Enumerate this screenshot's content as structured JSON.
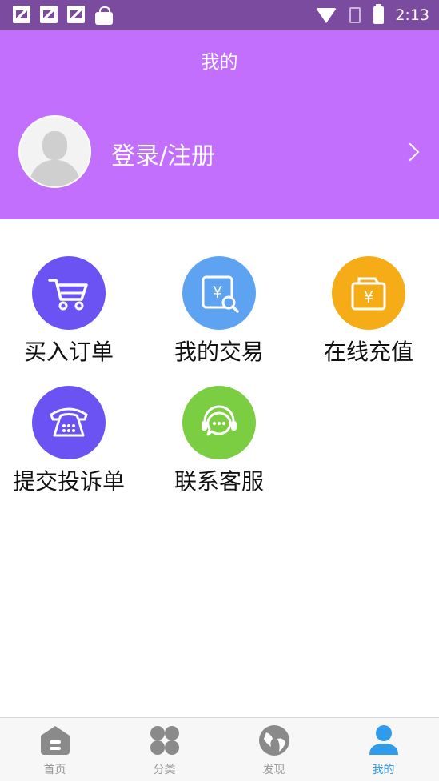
{
  "status_bar": {
    "time": "2:13"
  },
  "header": {
    "title": "我的",
    "login_label": "登录/注册"
  },
  "menu": {
    "items": [
      {
        "label": "买入订单",
        "icon": "shopping-cart-icon",
        "color": "#6a52f3"
      },
      {
        "label": "我的交易",
        "icon": "yuan-search-icon",
        "color": "#5ea3f1"
      },
      {
        "label": "在线充值",
        "icon": "wallet-yuan-icon",
        "color": "#f5ac16"
      },
      {
        "label": "提交投诉单",
        "icon": "telephone-icon",
        "color": "#6a52f3"
      },
      {
        "label": "联系客服",
        "icon": "headset-chat-icon",
        "color": "#7bcd42"
      }
    ]
  },
  "tabs": [
    {
      "label": "首页",
      "icon": "home-icon"
    },
    {
      "label": "分类",
      "icon": "category-icon"
    },
    {
      "label": "发现",
      "icon": "globe-icon"
    },
    {
      "label": "我的",
      "icon": "person-icon",
      "active": true
    }
  ],
  "colors": {
    "header_bg": "#c26ffd",
    "status_bar_bg": "#7b4ba0",
    "active_tab": "#2f9bea",
    "inactive_tab": "#9a9a9a"
  }
}
